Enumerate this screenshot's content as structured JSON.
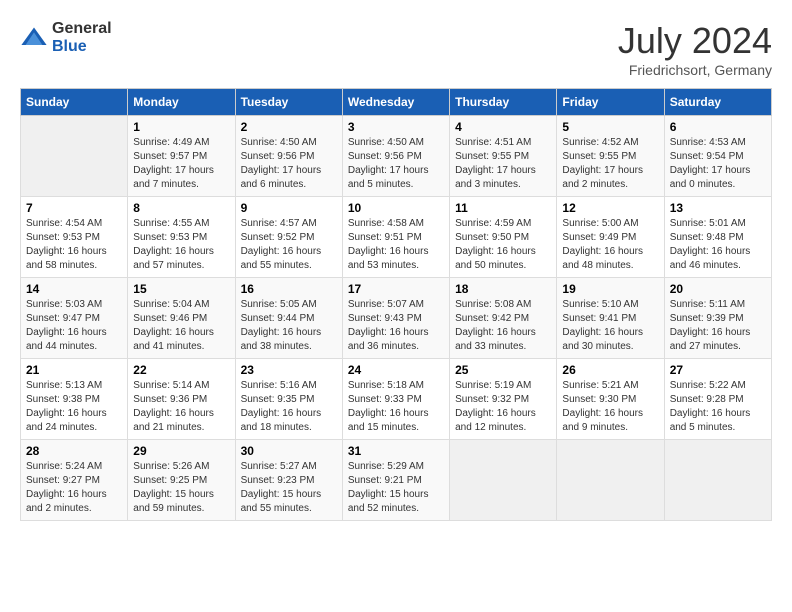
{
  "header": {
    "logo_general": "General",
    "logo_blue": "Blue",
    "month_title": "July 2024",
    "location": "Friedrichsort, Germany"
  },
  "weekdays": [
    "Sunday",
    "Monday",
    "Tuesday",
    "Wednesday",
    "Thursday",
    "Friday",
    "Saturday"
  ],
  "weeks": [
    [
      {
        "day": "",
        "info": ""
      },
      {
        "day": "1",
        "info": "Sunrise: 4:49 AM\nSunset: 9:57 PM\nDaylight: 17 hours\nand 7 minutes."
      },
      {
        "day": "2",
        "info": "Sunrise: 4:50 AM\nSunset: 9:56 PM\nDaylight: 17 hours\nand 6 minutes."
      },
      {
        "day": "3",
        "info": "Sunrise: 4:50 AM\nSunset: 9:56 PM\nDaylight: 17 hours\nand 5 minutes."
      },
      {
        "day": "4",
        "info": "Sunrise: 4:51 AM\nSunset: 9:55 PM\nDaylight: 17 hours\nand 3 minutes."
      },
      {
        "day": "5",
        "info": "Sunrise: 4:52 AM\nSunset: 9:55 PM\nDaylight: 17 hours\nand 2 minutes."
      },
      {
        "day": "6",
        "info": "Sunrise: 4:53 AM\nSunset: 9:54 PM\nDaylight: 17 hours\nand 0 minutes."
      }
    ],
    [
      {
        "day": "7",
        "info": "Sunrise: 4:54 AM\nSunset: 9:53 PM\nDaylight: 16 hours\nand 58 minutes."
      },
      {
        "day": "8",
        "info": "Sunrise: 4:55 AM\nSunset: 9:53 PM\nDaylight: 16 hours\nand 57 minutes."
      },
      {
        "day": "9",
        "info": "Sunrise: 4:57 AM\nSunset: 9:52 PM\nDaylight: 16 hours\nand 55 minutes."
      },
      {
        "day": "10",
        "info": "Sunrise: 4:58 AM\nSunset: 9:51 PM\nDaylight: 16 hours\nand 53 minutes."
      },
      {
        "day": "11",
        "info": "Sunrise: 4:59 AM\nSunset: 9:50 PM\nDaylight: 16 hours\nand 50 minutes."
      },
      {
        "day": "12",
        "info": "Sunrise: 5:00 AM\nSunset: 9:49 PM\nDaylight: 16 hours\nand 48 minutes."
      },
      {
        "day": "13",
        "info": "Sunrise: 5:01 AM\nSunset: 9:48 PM\nDaylight: 16 hours\nand 46 minutes."
      }
    ],
    [
      {
        "day": "14",
        "info": "Sunrise: 5:03 AM\nSunset: 9:47 PM\nDaylight: 16 hours\nand 44 minutes."
      },
      {
        "day": "15",
        "info": "Sunrise: 5:04 AM\nSunset: 9:46 PM\nDaylight: 16 hours\nand 41 minutes."
      },
      {
        "day": "16",
        "info": "Sunrise: 5:05 AM\nSunset: 9:44 PM\nDaylight: 16 hours\nand 38 minutes."
      },
      {
        "day": "17",
        "info": "Sunrise: 5:07 AM\nSunset: 9:43 PM\nDaylight: 16 hours\nand 36 minutes."
      },
      {
        "day": "18",
        "info": "Sunrise: 5:08 AM\nSunset: 9:42 PM\nDaylight: 16 hours\nand 33 minutes."
      },
      {
        "day": "19",
        "info": "Sunrise: 5:10 AM\nSunset: 9:41 PM\nDaylight: 16 hours\nand 30 minutes."
      },
      {
        "day": "20",
        "info": "Sunrise: 5:11 AM\nSunset: 9:39 PM\nDaylight: 16 hours\nand 27 minutes."
      }
    ],
    [
      {
        "day": "21",
        "info": "Sunrise: 5:13 AM\nSunset: 9:38 PM\nDaylight: 16 hours\nand 24 minutes."
      },
      {
        "day": "22",
        "info": "Sunrise: 5:14 AM\nSunset: 9:36 PM\nDaylight: 16 hours\nand 21 minutes."
      },
      {
        "day": "23",
        "info": "Sunrise: 5:16 AM\nSunset: 9:35 PM\nDaylight: 16 hours\nand 18 minutes."
      },
      {
        "day": "24",
        "info": "Sunrise: 5:18 AM\nSunset: 9:33 PM\nDaylight: 16 hours\nand 15 minutes."
      },
      {
        "day": "25",
        "info": "Sunrise: 5:19 AM\nSunset: 9:32 PM\nDaylight: 16 hours\nand 12 minutes."
      },
      {
        "day": "26",
        "info": "Sunrise: 5:21 AM\nSunset: 9:30 PM\nDaylight: 16 hours\nand 9 minutes."
      },
      {
        "day": "27",
        "info": "Sunrise: 5:22 AM\nSunset: 9:28 PM\nDaylight: 16 hours\nand 5 minutes."
      }
    ],
    [
      {
        "day": "28",
        "info": "Sunrise: 5:24 AM\nSunset: 9:27 PM\nDaylight: 16 hours\nand 2 minutes."
      },
      {
        "day": "29",
        "info": "Sunrise: 5:26 AM\nSunset: 9:25 PM\nDaylight: 15 hours\nand 59 minutes."
      },
      {
        "day": "30",
        "info": "Sunrise: 5:27 AM\nSunset: 9:23 PM\nDaylight: 15 hours\nand 55 minutes."
      },
      {
        "day": "31",
        "info": "Sunrise: 5:29 AM\nSunset: 9:21 PM\nDaylight: 15 hours\nand 52 minutes."
      },
      {
        "day": "",
        "info": ""
      },
      {
        "day": "",
        "info": ""
      },
      {
        "day": "",
        "info": ""
      }
    ]
  ]
}
